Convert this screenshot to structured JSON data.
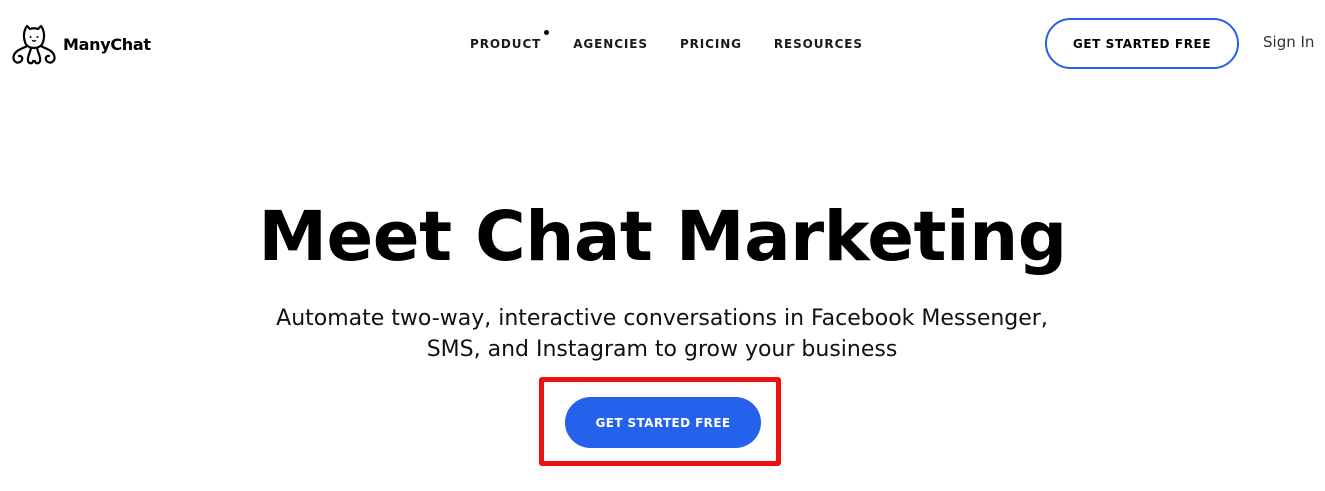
{
  "header": {
    "logo": {
      "icon": "manychat-octopus-logo-icon",
      "text": "ManyChat"
    },
    "nav": {
      "items": [
        {
          "label": "PRODUCT",
          "has_indicator_dot": true
        },
        {
          "label": "AGENCIES"
        },
        {
          "label": "PRICING"
        },
        {
          "label": "RESOURCES"
        }
      ]
    },
    "cta_label": "GET STARTED FREE",
    "signin_label": "Sign In"
  },
  "hero": {
    "title": "Meet Chat Marketing",
    "subtitle": "Automate two-way, interactive conversations in Facebook Messenger, SMS, and Instagram to grow your business",
    "cta_label": "GET STARTED FREE"
  },
  "colors": {
    "accent": "#2462ec",
    "header_cta_border": "#2660e8",
    "highlight": "#ee1111",
    "text": "#000000",
    "background": "#ffffff"
  }
}
